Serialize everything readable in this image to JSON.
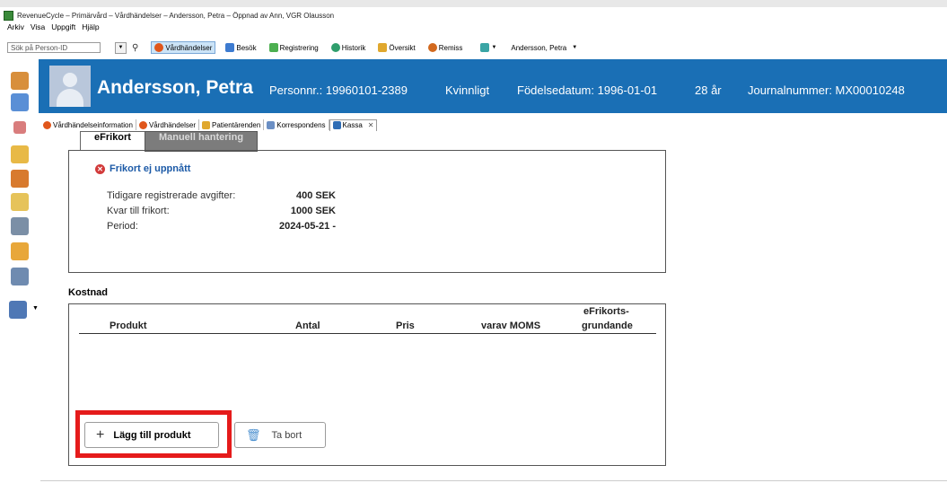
{
  "window": {
    "title": "RevenueCycle – Primärvård – Vårdhändelser – Andersson, Petra – Öppnad av Ann, VGR Olausson"
  },
  "menu": [
    "Arkiv",
    "Visa",
    "Uppgift",
    "Hjälp"
  ],
  "toolbar": {
    "search_placeholder": "Sök på Person-ID",
    "buttons": [
      {
        "label": "Vårdhändelser",
        "icon": "vardhandelser-icon",
        "color": "#e0561b",
        "active": true
      },
      {
        "label": "Besök",
        "icon": "besok-icon",
        "color": "#3d7bd0"
      },
      {
        "label": "Registrering",
        "icon": "registrering-icon",
        "color": "#4caf50"
      },
      {
        "label": "Historik",
        "icon": "historik-icon",
        "color": "#2f9e6c"
      },
      {
        "label": "Översikt",
        "icon": "oversikt-icon",
        "color": "#e0a82e"
      },
      {
        "label": "Remiss",
        "icon": "remiss-icon",
        "color": "#d2691e"
      }
    ],
    "user_menu": "Andersson, Petra"
  },
  "patient": {
    "name": "Andersson, Petra",
    "personnr": "Personnr.: 19960101-2389",
    "gender": "Kvinnligt",
    "birthdate": "Födelsedatum: 1996-01-01",
    "age": "28 år",
    "journal": "Journalnummer: MX00010248"
  },
  "tabs": [
    {
      "label": "Vårdhändelseinformation",
      "icon": "info-icon",
      "color": "#e0561b"
    },
    {
      "label": "Vårdhändelser",
      "icon": "vardhandelser-icon",
      "color": "#e0561b"
    },
    {
      "label": "Patientärenden",
      "icon": "folder-icon",
      "color": "#e0a82e"
    },
    {
      "label": "Korrespondens",
      "icon": "mail-icon",
      "color": "#6b8fc4"
    },
    {
      "label": "Kassa",
      "icon": "kassa-icon",
      "color": "#2f6db5",
      "active": true
    }
  ],
  "subtabs": {
    "efrikort": "eFrikort",
    "manuell": "Manuell hantering"
  },
  "frikort": {
    "status": "Frikort ej uppnått",
    "rows": [
      {
        "label": "Tidigare registrerade avgifter:",
        "value": "400 SEK"
      },
      {
        "label": "Kvar till frikort:",
        "value": "1000 SEK"
      },
      {
        "label": "Period:",
        "value": "2024-05-21 -"
      }
    ]
  },
  "kostnad": {
    "title": "Kostnad",
    "columns": {
      "produkt": "Produkt",
      "antal": "Antal",
      "pris": "Pris",
      "moms": "varav MOMS",
      "efrikort_line1": "eFrikorts-",
      "efrikort_line2": "grundande"
    },
    "add_button": "Lägg till produkt",
    "remove_button": "Ta bort"
  },
  "colors": {
    "header_blue": "#1a6fb5",
    "highlight_red": "#e51b1b"
  }
}
